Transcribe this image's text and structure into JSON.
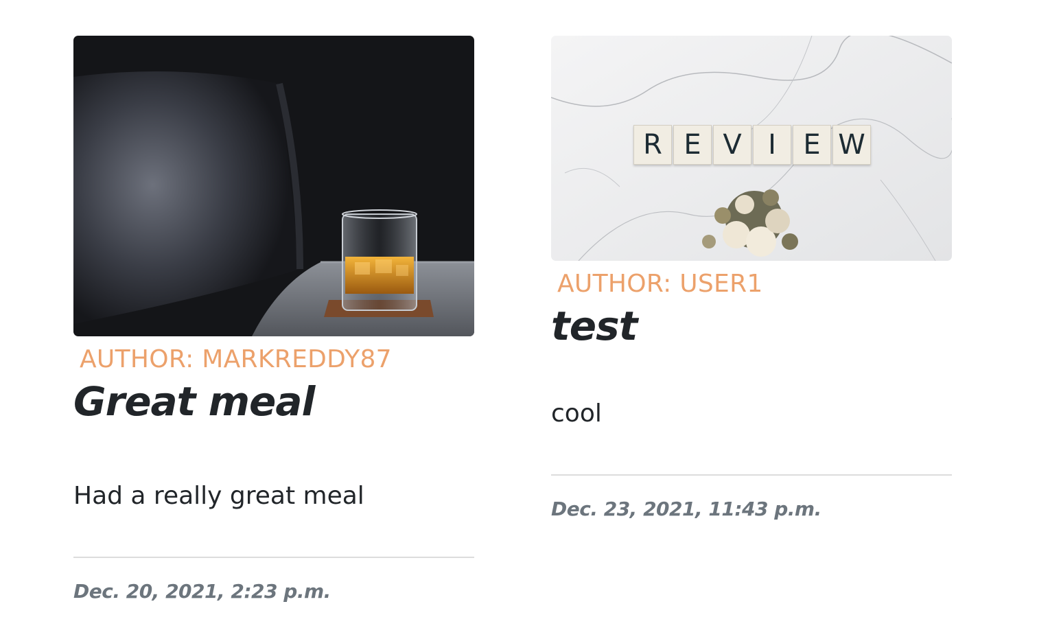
{
  "posts": [
    {
      "author": "AUTHOR: MARKREDDY87",
      "title": "Great meal",
      "excerpt": "Had a really great meal",
      "date": "Dec. 20, 2021, 2:23 p.m."
    },
    {
      "author": "AUTHOR: USER1",
      "title": "test",
      "excerpt": "cool",
      "date": "Dec. 23, 2021, 11:43 p.m.",
      "image_tiles": [
        "R",
        "E",
        "V",
        "I",
        "E",
        "W"
      ]
    }
  ],
  "colors": {
    "author": "#eca16b",
    "title": "#212529",
    "date": "#6c757d",
    "divider": "#dcdcdc"
  }
}
